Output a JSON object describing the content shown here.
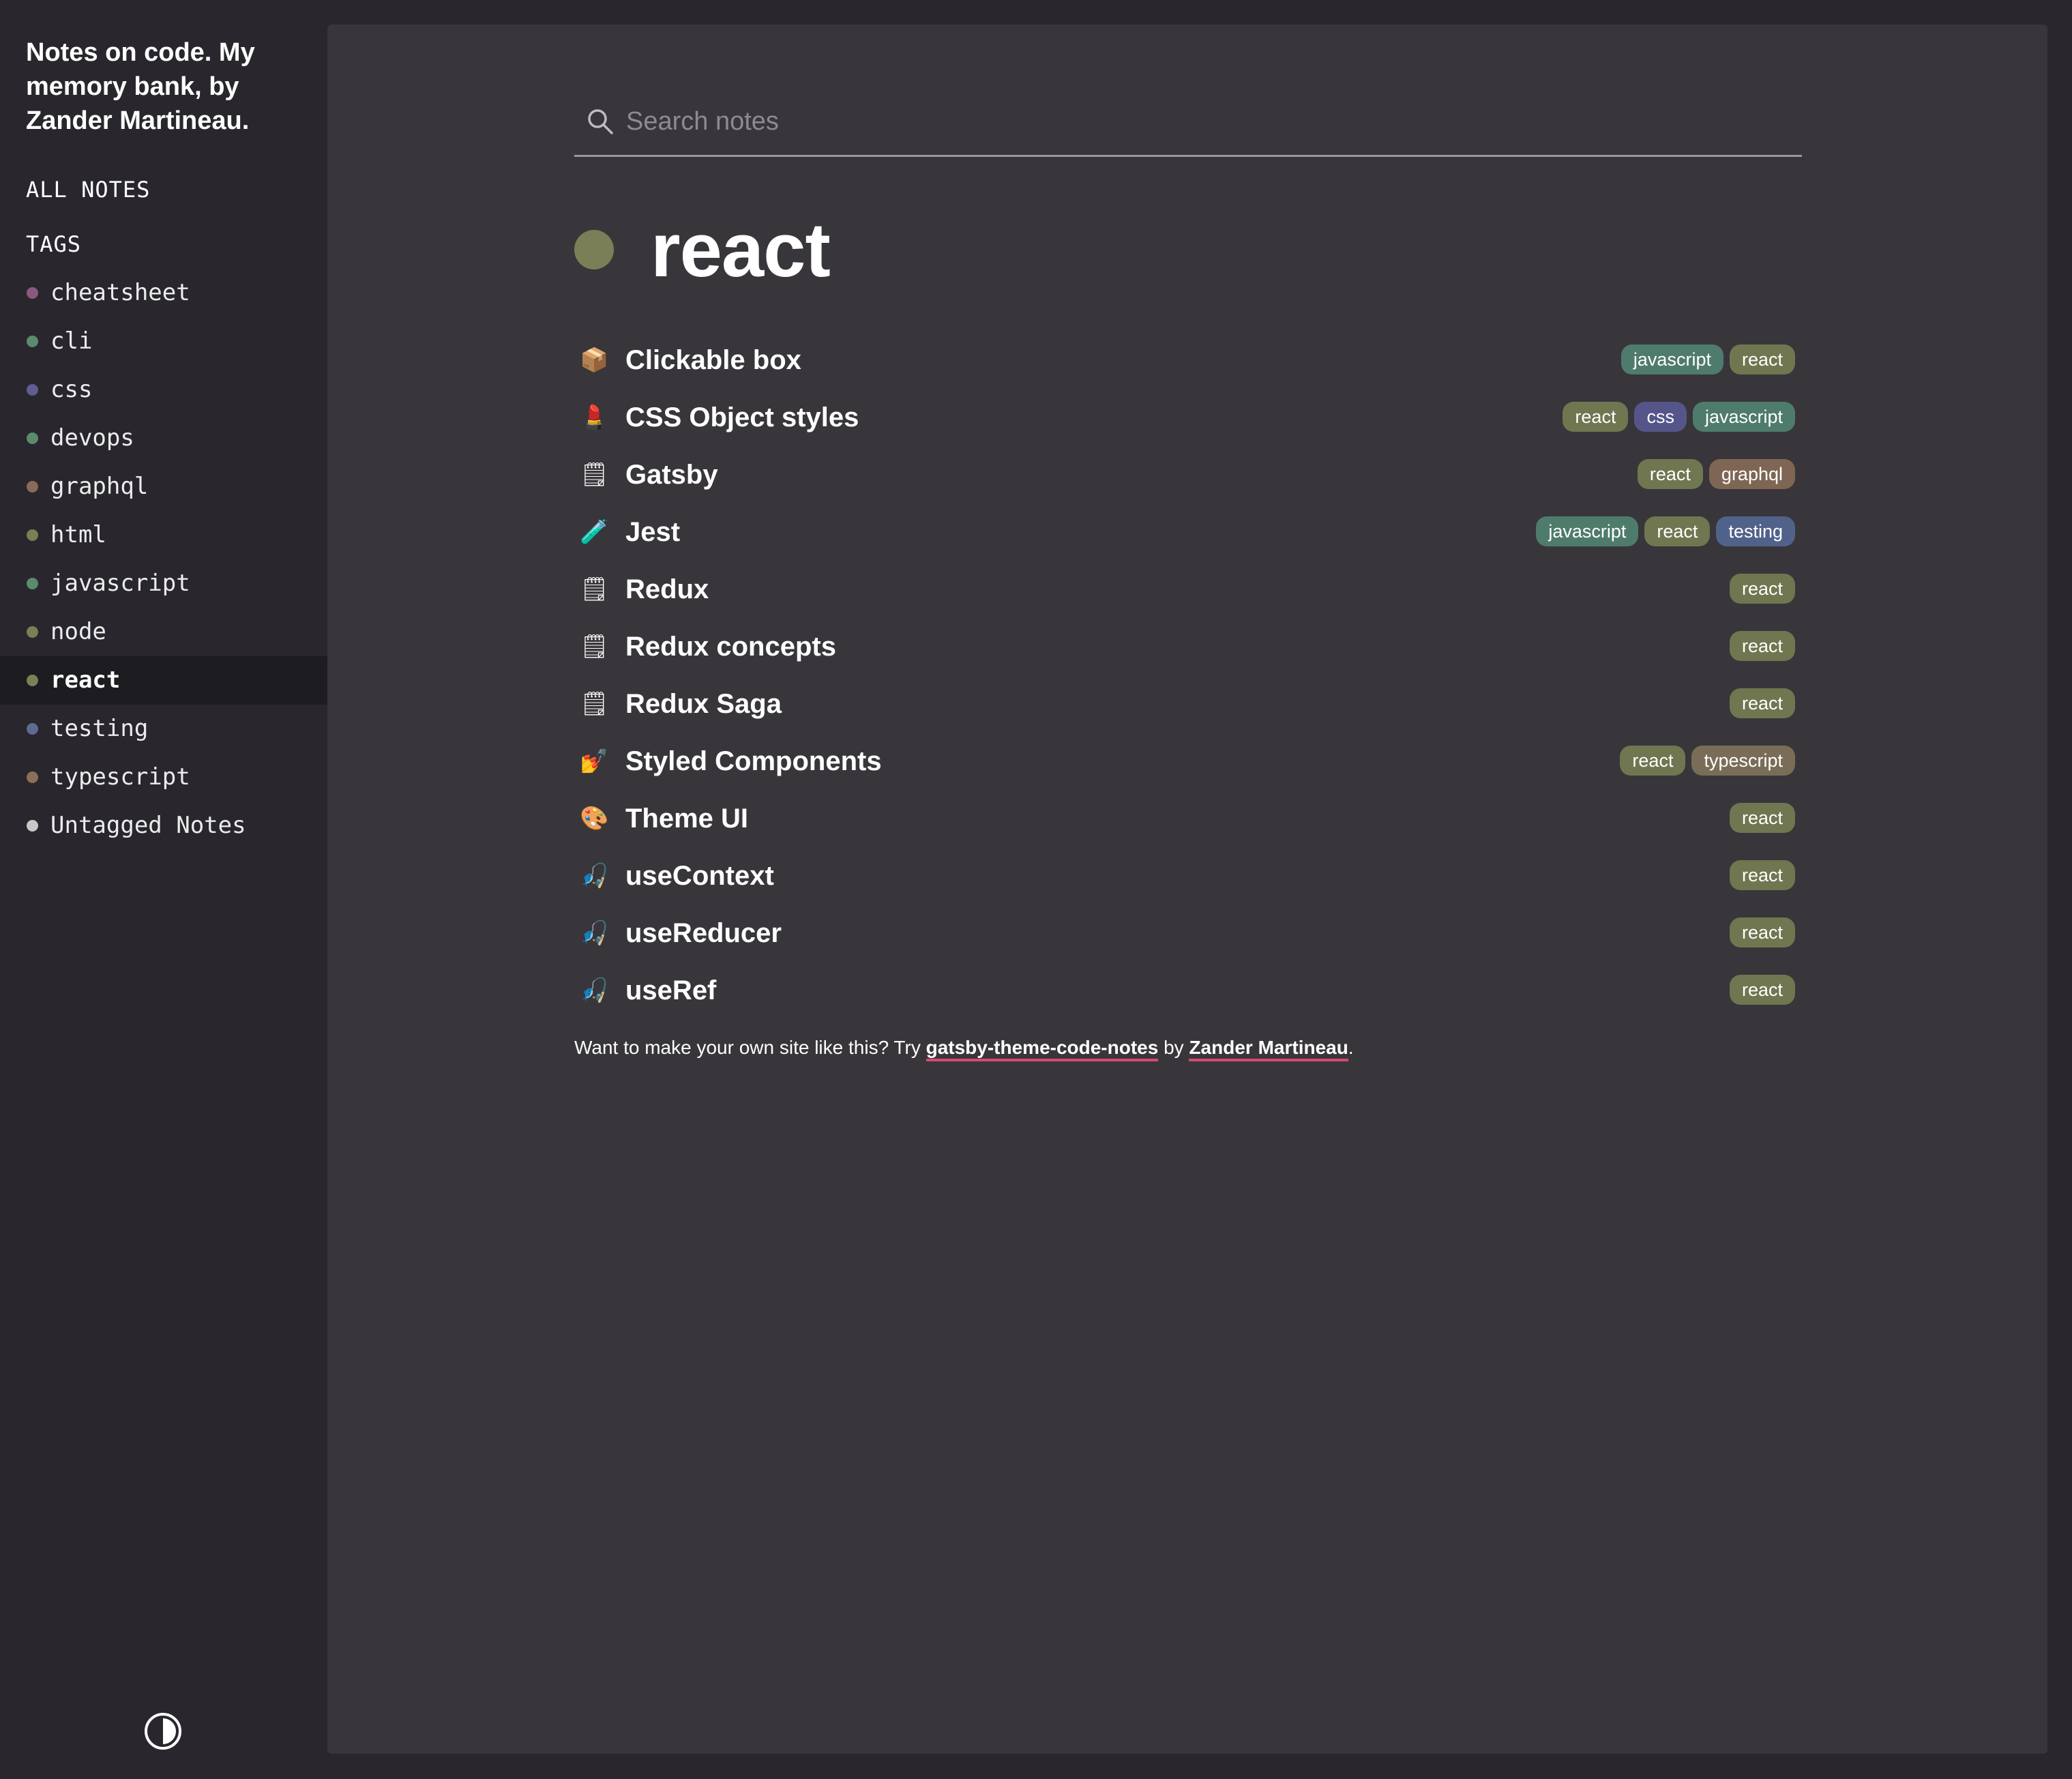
{
  "sidebar": {
    "site_title": "Notes on code. My memory bank, by Zander Martineau.",
    "all_notes_label": "ALL NOTES",
    "tags_heading": "TAGS",
    "tags": [
      {
        "name": "cheatsheet",
        "color": "#8a5a7e",
        "active": false
      },
      {
        "name": "cli",
        "color": "#5c8a6e",
        "active": false
      },
      {
        "name": "css",
        "color": "#5e5e92",
        "active": false
      },
      {
        "name": "devops",
        "color": "#5c8a6e",
        "active": false
      },
      {
        "name": "graphql",
        "color": "#8a6a58",
        "active": false
      },
      {
        "name": "html",
        "color": "#7a7f58",
        "active": false
      },
      {
        "name": "javascript",
        "color": "#5c8a6e",
        "active": false
      },
      {
        "name": "node",
        "color": "#7a7f58",
        "active": false
      },
      {
        "name": "react",
        "color": "#7a7f58",
        "active": true
      },
      {
        "name": "testing",
        "color": "#5e6a92",
        "active": false
      },
      {
        "name": "typescript",
        "color": "#8a7058",
        "active": false
      },
      {
        "name": "Untagged Notes",
        "color": "#c8c8c8",
        "active": false
      }
    ],
    "theme_toggle_icon": "contrast-icon"
  },
  "search": {
    "placeholder": "Search notes",
    "value": "",
    "icon": "search-icon"
  },
  "page": {
    "heading": "react",
    "heading_color": "#7a7f58"
  },
  "tag_colors": {
    "javascript": "#4f7b6c",
    "react": "#707650",
    "css": "#56558a",
    "graphql": "#7f6654",
    "testing": "#51628a",
    "typescript": "#7a6d57"
  },
  "notes": [
    {
      "emoji": "📦",
      "title": "Clickable box",
      "tags": [
        "javascript",
        "react"
      ]
    },
    {
      "emoji": "💄",
      "title": "CSS Object styles",
      "tags": [
        "react",
        "css",
        "javascript"
      ]
    },
    {
      "emoji": "🗒",
      "title": "Gatsby",
      "tags": [
        "react",
        "graphql"
      ]
    },
    {
      "emoji": "🧪",
      "title": "Jest",
      "tags": [
        "javascript",
        "react",
        "testing"
      ]
    },
    {
      "emoji": "🗒",
      "title": "Redux",
      "tags": [
        "react"
      ]
    },
    {
      "emoji": "🗒",
      "title": "Redux concepts",
      "tags": [
        "react"
      ]
    },
    {
      "emoji": "🗒",
      "title": "Redux Saga",
      "tags": [
        "react"
      ]
    },
    {
      "emoji": "💅",
      "title": "Styled Components",
      "tags": [
        "react",
        "typescript"
      ]
    },
    {
      "emoji": "🎨",
      "title": "Theme UI",
      "tags": [
        "react"
      ]
    },
    {
      "emoji": "🎣",
      "title": "useContext",
      "tags": [
        "react"
      ]
    },
    {
      "emoji": "🎣",
      "title": "useReducer",
      "tags": [
        "react"
      ]
    },
    {
      "emoji": "🎣",
      "title": "useRef",
      "tags": [
        "react"
      ]
    }
  ],
  "footer": {
    "text_before": "Want to make your own site like this? Try ",
    "link1_text": "gatsby-theme-code-notes",
    "text_middle": " by ",
    "link2_text": "Zander Martineau",
    "text_after": ".",
    "link_underline_color": "#d9476f"
  }
}
